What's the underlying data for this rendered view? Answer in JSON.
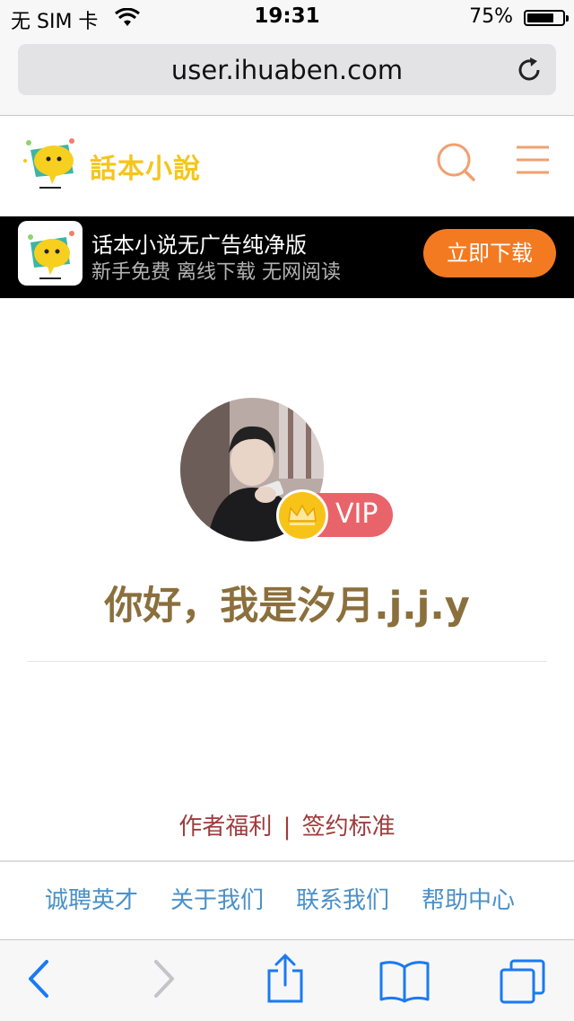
{
  "status_bar": {
    "carrier": "无 SIM 卡",
    "time": "19:31",
    "battery_percent_text": "75%",
    "battery_level": 0.75
  },
  "browser": {
    "url": "user.ihuaben.com"
  },
  "site": {
    "logo_text": "話本小說"
  },
  "app_banner": {
    "title": "话本小说无广告纯净版",
    "subtitle": "新手免费 离线下载 无网阅读",
    "button_label": "立即下载",
    "button_color": "#f37a20"
  },
  "profile": {
    "vip_label": "VIP",
    "greeting": "你好，我是汐月.j.j.y"
  },
  "footer": {
    "link_author_benefits": "作者福利",
    "separator": "|",
    "link_sign_standard": "签约标准",
    "bottom_links": [
      "诚聘英才",
      "关于我们",
      "联系我们",
      "帮助中心"
    ]
  },
  "colors": {
    "greeting": "#8b6f3c",
    "footer_link": "#9e3b3b",
    "bottom_link": "#4a90c8",
    "vip_badge": "#e8646a",
    "logo": "#f5c51b",
    "header_icons": "#f0a070",
    "ios_blue": "#1a7af2"
  }
}
